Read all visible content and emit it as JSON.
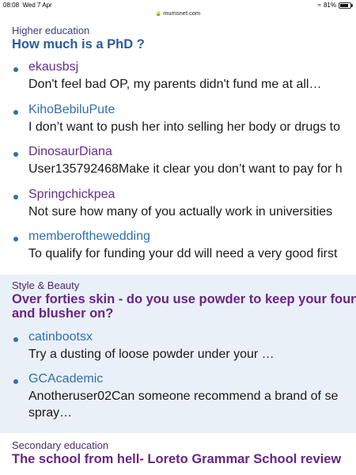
{
  "status_bar": {
    "time": "08:08",
    "date": "Wed 7 Apr",
    "url": "mumsnet.com",
    "battery": "81%",
    "battery_level": 0.81
  },
  "sections": [
    {
      "category": "Higher education",
      "title": "How much is a PhD ?",
      "posts": [
        {
          "author": "ekausbsj",
          "snippet": "Don't feel bad OP, my parents didn't fund me at all…"
        },
        {
          "author": "KihoBebiluPute",
          "snippet": "I don’t want to push her into selling her body or drugs to"
        },
        {
          "author": "DinosaurDiana",
          "snippet": "User135792468Make it clear you don’t want to pay for h"
        },
        {
          "author": "Springchickpea",
          "snippet": "Not sure how many of you actually work in universities"
        },
        {
          "author": "memberofthewedding",
          "snippet": "To qualify for funding your dd will need a very good first"
        }
      ]
    },
    {
      "category": "Style & Beauty",
      "title_lines": [
        "Over forties skin - do you use powder to keep your founda",
        "and blusher on?"
      ],
      "posts": [
        {
          "author": "catinbootsx",
          "snippet": "Try a dusting of loose powder under your …"
        },
        {
          "author": "GCAcademic",
          "snippet_lines": [
            "Anotheruser02Can someone recommend a brand of se",
            "spray…"
          ]
        }
      ]
    },
    {
      "category": "Secondary education",
      "title": "The school from hell- Loreto Grammar School review"
    }
  ]
}
